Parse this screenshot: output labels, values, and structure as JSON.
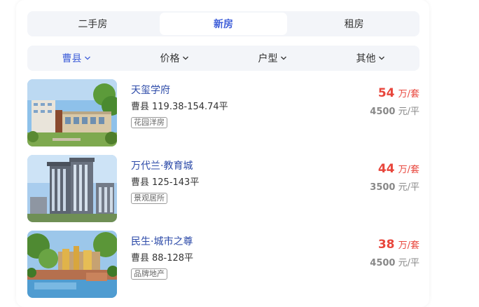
{
  "tabs": [
    {
      "label": "二手房"
    },
    {
      "label": "新房"
    },
    {
      "label": "租房"
    }
  ],
  "active_tab": "新房",
  "filters": [
    {
      "label": "曹县"
    },
    {
      "label": "价格"
    },
    {
      "label": "户型"
    },
    {
      "label": "其他"
    }
  ],
  "colors": {
    "accent": "#3f5fd9",
    "price_red": "#e8463c",
    "link_blue": "#2c4aa8",
    "panel_bg": "#f3f5f9"
  },
  "listings": [
    {
      "name": "天玺学府",
      "district": "曹县",
      "area": "119.38-154.74平",
      "tag": "花园洋房",
      "price_num": "54",
      "price_unit": "万/套",
      "unit_price_num": "4500",
      "unit_price_unit": "元/平"
    },
    {
      "name": "万代兰·教育城",
      "district": "曹县",
      "area": "125-143平",
      "tag": "景观居所",
      "price_num": "44",
      "price_unit": "万/套",
      "unit_price_num": "3500",
      "unit_price_unit": "元/平"
    },
    {
      "name": "民生·城市之尊",
      "district": "曹县",
      "area": "88-128平",
      "tag": "品牌地产",
      "price_num": "38",
      "price_unit": "万/套",
      "unit_price_num": "4500",
      "unit_price_unit": "元/平"
    }
  ]
}
